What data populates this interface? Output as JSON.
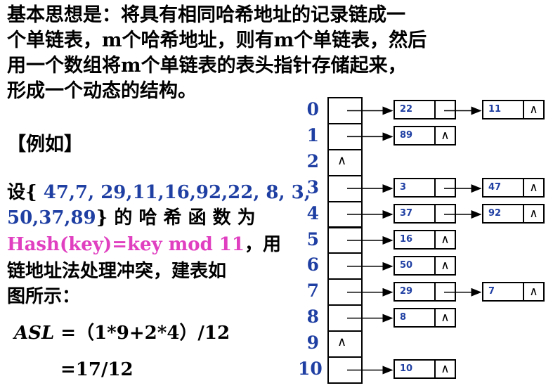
{
  "intro": {
    "line1": "基本思想是：将具有相同哈希地址的记录链成一",
    "line2": "个单链表，m个哈希地址，则有m个单链表，然后",
    "line3": "用一个数组将m个单链表的表头指针存储起来，",
    "line4": "形成一个动态的结构。"
  },
  "example": {
    "heading": "【例如】",
    "set_prefix": "设{ ",
    "set_values_1": "47,7, 29,11,16,92,22, 8, 3,",
    "set_values_2": "50,37,89",
    "set_suffix": "} 的 哈 希 函 数 为",
    "hash_fn": "Hash(key)=key mod 11",
    "hash_suffix": "，用",
    "desc_line1": "链地址法处理冲突，建表如",
    "desc_line2": "图所示：",
    "asl_label": "ASL",
    "asl_expr": " =（1*9+2*4）/12",
    "asl_result": "=17/12"
  },
  "table": {
    "indices": [
      "0",
      "1",
      "2",
      "3",
      "4",
      "5",
      "6",
      "7",
      "8",
      "9",
      "10"
    ],
    "null_symbol": "∧",
    "chains": [
      [
        "22",
        "11"
      ],
      [
        "89"
      ],
      [],
      [
        "3",
        "47"
      ],
      [
        "37",
        "92"
      ],
      [
        "16"
      ],
      [
        "50"
      ],
      [
        "29",
        "7"
      ],
      [
        "8"
      ],
      [],
      [
        "10"
      ]
    ]
  },
  "colors": {
    "accent_blue": "#1f3fa3",
    "highlight_pink": "#e040c0"
  }
}
